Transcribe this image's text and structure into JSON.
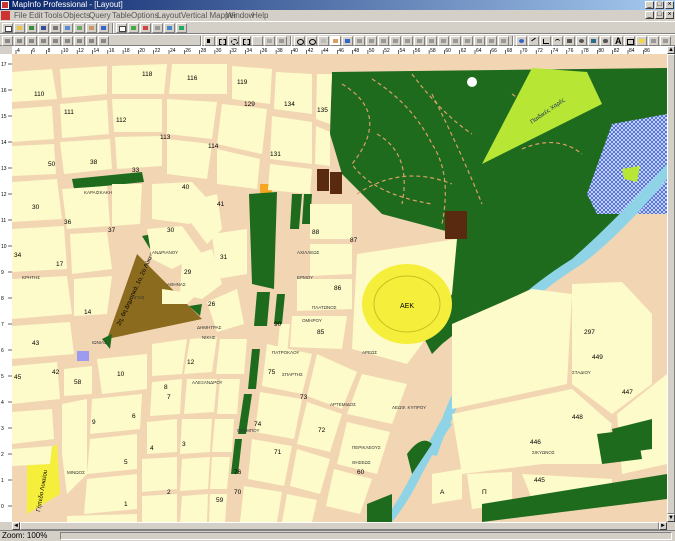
{
  "window": {
    "title": "MapInfo Professional - [Layout]",
    "controls": [
      "_",
      "□",
      "×"
    ]
  },
  "menu": {
    "items": [
      "File",
      "Edit",
      "Tools",
      "Objects",
      "Query",
      "Table",
      "Options",
      "Layout",
      "Vertical Mapper",
      "Window",
      "Help"
    ]
  },
  "status": {
    "zoom": "Zoom: 100%"
  },
  "map": {
    "stadium_label": "AEK",
    "park_label": "Παιδικές Χαρές",
    "triangle_label": "2η, 6η Δημοτικά, 1ο, 2ο Λύκεια",
    "field_label": "Γήπεδο Λυκείου",
    "block_numbers": [
      "116",
      "118",
      "119",
      "129",
      "134",
      "135",
      "110",
      "111",
      "112",
      "113",
      "114",
      "131",
      "50",
      "38",
      "33",
      "30",
      "36",
      "37",
      "34",
      "17",
      "14",
      "40",
      "41",
      "30",
      "29",
      "31",
      "26",
      "88",
      "87",
      "86",
      "90",
      "85",
      "12",
      "10",
      "9",
      "8",
      "7",
      "6",
      "5",
      "4",
      "3",
      "2",
      "1",
      "76",
      "75",
      "74",
      "73",
      "72",
      "71",
      "70",
      "60",
      "59",
      "58",
      "45",
      "43",
      "42",
      "297",
      "449",
      "448",
      "447",
      "446",
      "445",
      "A",
      "Π"
    ],
    "street_labels": [
      "ΚΑΡΑΙΣΚΑΚΗ",
      "ΑΝΔΡΙΑΝΟΥ",
      "ΑΘΗΝΑΣ",
      "ΑΧΙΛΛΕΩΣ",
      "ΕΡΜΟΥ",
      "ΝΙΚΗΣ",
      "ΠΑΤΡΟΚΛΟΥ",
      "ΣΠΑΡΤΗΣ",
      "ΑΡΤΕΜΙΔΟΣ",
      "ΠΕΡΙΚΛΕΟΥΣ",
      "ΜΙΝΩΟΣ",
      "ΑΛΕΞΑΝΔΡΟΥ",
      "ΟΛΥΜΠΟΥ",
      "ΔΗΜΗΤΡΑΣ",
      "ΠΛΑΤΩΝΟΣ",
      "ΟΜΗΡΟΥ",
      "ΘΗΣΕΩΣ",
      "ΑΓΙΑΣ",
      "ΚΡΗΤΗΣ",
      "ΣΙΚΥΩΝΟΣ",
      "ΣΤΑΔΙΟΥ",
      "ΑΡΕΩΣ",
      "ΛΕΩΦ. ΚΥΠΡΟΥ",
      "ΙΩΝΙΑΣ"
    ],
    "ruler_top_ticks": [
      "4",
      "6",
      "8",
      "10",
      "12",
      "14",
      "16",
      "18",
      "20",
      "22",
      "24",
      "26",
      "28",
      "30",
      "32",
      "34",
      "36",
      "38",
      "40",
      "42",
      "44",
      "46",
      "48",
      "50",
      "52",
      "54",
      "56",
      "58",
      "60",
      "62",
      "64",
      "66",
      "68",
      "70",
      "72",
      "74",
      "76",
      "78",
      "80",
      "82",
      "84",
      "86"
    ],
    "ruler_left_ticks": [
      "17",
      "16",
      "15",
      "14",
      "13",
      "12",
      "11",
      "10",
      "9",
      "8",
      "7",
      "6",
      "5",
      "4",
      "3",
      "2",
      "1",
      "0"
    ]
  },
  "colors": {
    "block_fill": "#fdfbc9",
    "street": "#f2d6b4",
    "park": "#1e6b1e",
    "light_green": "#b7e634",
    "stadium": "#f5ef3c",
    "river": "#8fd3e6",
    "school": "#8b6b1e",
    "brown": "#5a2a10",
    "orange": "#f5a623",
    "blue_hatch": "#3a5fcf",
    "title_bar": "#0a246a"
  }
}
